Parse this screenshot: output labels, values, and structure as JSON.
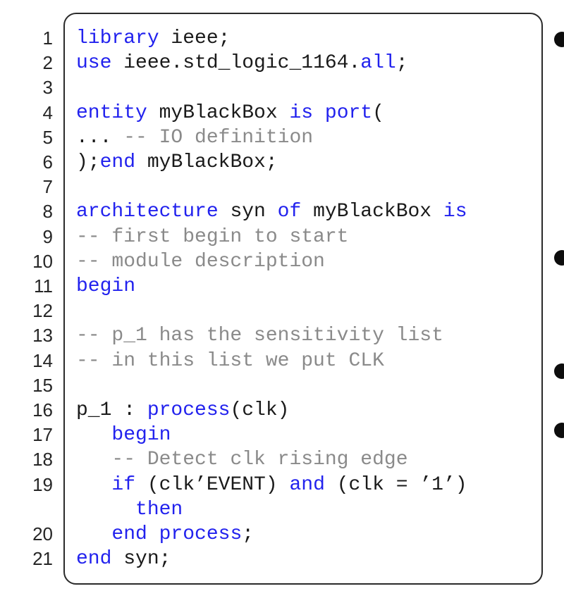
{
  "colors": {
    "keyword": "#2222ee",
    "comment": "#8a8a8a",
    "text": "#1a1a1a"
  },
  "lines": [
    {
      "num": "1",
      "segs": [
        {
          "t": "library",
          "k": "kw"
        },
        {
          "t": " ieee;",
          "k": "tx"
        }
      ]
    },
    {
      "num": "2",
      "segs": [
        {
          "t": "use",
          "k": "kw"
        },
        {
          "t": " ieee.std_logic_1164.",
          "k": "tx"
        },
        {
          "t": "all",
          "k": "kw"
        },
        {
          "t": ";",
          "k": "tx"
        }
      ]
    },
    {
      "num": "3",
      "segs": []
    },
    {
      "num": "4",
      "segs": [
        {
          "t": "entity",
          "k": "kw"
        },
        {
          "t": " myBlackBox ",
          "k": "tx"
        },
        {
          "t": "is",
          "k": "kw"
        },
        {
          "t": " ",
          "k": "tx"
        },
        {
          "t": "port",
          "k": "kw"
        },
        {
          "t": "(",
          "k": "tx"
        }
      ]
    },
    {
      "num": "5",
      "segs": [
        {
          "t": "... ",
          "k": "tx"
        },
        {
          "t": "-- IO definition",
          "k": "cm"
        }
      ]
    },
    {
      "num": "6",
      "segs": [
        {
          "t": ");",
          "k": "tx"
        },
        {
          "t": "end",
          "k": "kw"
        },
        {
          "t": " myBlackBox;",
          "k": "tx"
        }
      ]
    },
    {
      "num": "7",
      "segs": []
    },
    {
      "num": "8",
      "segs": [
        {
          "t": "architecture",
          "k": "kw"
        },
        {
          "t": " syn ",
          "k": "tx"
        },
        {
          "t": "of",
          "k": "kw"
        },
        {
          "t": " myBlackBox ",
          "k": "tx"
        },
        {
          "t": "is",
          "k": "kw"
        }
      ]
    },
    {
      "num": "9",
      "segs": [
        {
          "t": "-- first begin to start",
          "k": "cm"
        }
      ]
    },
    {
      "num": "10",
      "segs": [
        {
          "t": "-- module description",
          "k": "cm"
        }
      ]
    },
    {
      "num": "11",
      "segs": [
        {
          "t": "begin",
          "k": "kw"
        }
      ]
    },
    {
      "num": "12",
      "segs": []
    },
    {
      "num": "13",
      "segs": [
        {
          "t": "-- p_1 has the sensitivity list",
          "k": "cm"
        }
      ]
    },
    {
      "num": "14",
      "segs": [
        {
          "t": "-- in this list we put CLK",
          "k": "cm"
        }
      ]
    },
    {
      "num": "15",
      "segs": []
    },
    {
      "num": "16",
      "segs": [
        {
          "t": "p_1 : ",
          "k": "tx"
        },
        {
          "t": "process",
          "k": "kw"
        },
        {
          "t": "(clk)",
          "k": "tx"
        }
      ]
    },
    {
      "num": "17",
      "segs": [
        {
          "t": "   ",
          "k": "tx"
        },
        {
          "t": "begin",
          "k": "kw"
        }
      ]
    },
    {
      "num": "18",
      "segs": [
        {
          "t": "   ",
          "k": "tx"
        },
        {
          "t": "-- Detect clk rising edge",
          "k": "cm"
        }
      ]
    },
    {
      "num": "19",
      "segs": [
        {
          "t": "   ",
          "k": "tx"
        },
        {
          "t": "if",
          "k": "kw"
        },
        {
          "t": " (clk’EVENT) ",
          "k": "tx"
        },
        {
          "t": "and",
          "k": "kw"
        },
        {
          "t": " (clk = ’1’)",
          "k": "tx"
        }
      ]
    },
    {
      "num": "",
      "segs": [
        {
          "t": "     ",
          "k": "tx"
        },
        {
          "t": "then",
          "k": "kw"
        }
      ]
    },
    {
      "num": "20",
      "segs": [
        {
          "t": "   ",
          "k": "tx"
        },
        {
          "t": "end process",
          "k": "kw"
        },
        {
          "t": ";",
          "k": "tx"
        }
      ]
    },
    {
      "num": "21",
      "segs": [
        {
          "t": "end",
          "k": "kw"
        },
        {
          "t": " syn;",
          "k": "tx"
        }
      ]
    }
  ]
}
